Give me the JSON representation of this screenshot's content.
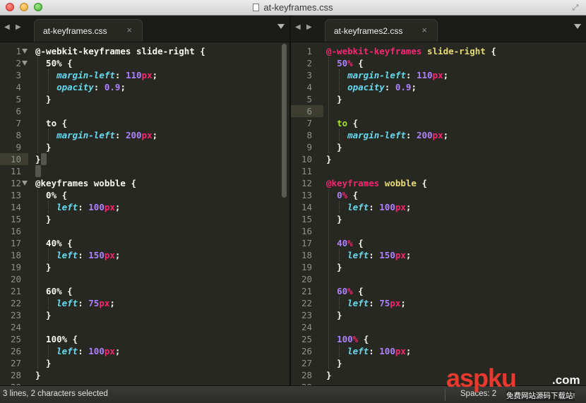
{
  "window": {
    "title": "at-keyframes.css"
  },
  "panes": [
    {
      "id": "left",
      "tab_label": "at-keyframes.css",
      "close_glyph": "×",
      "nav_back": "◀",
      "nav_forward": "▶",
      "current_line": 10,
      "selection_lines": [
        10,
        11
      ],
      "folded_lines": [
        1,
        2,
        12
      ],
      "lines": [
        [
          {
            "t": "@-webkit-keyframes slide-right {",
            "c": "w"
          }
        ],
        [
          {
            "t": "  50% {",
            "c": "w"
          }
        ],
        [
          {
            "t": "    ",
            "c": "w"
          },
          {
            "t": "margin-left",
            "c": "pr"
          },
          {
            "t": ": ",
            "c": "w"
          },
          {
            "t": "110",
            "c": "num"
          },
          {
            "t": "px",
            "c": "unit"
          },
          {
            "t": ";",
            "c": "w"
          }
        ],
        [
          {
            "t": "    ",
            "c": "w"
          },
          {
            "t": "opacity",
            "c": "pr"
          },
          {
            "t": ": ",
            "c": "w"
          },
          {
            "t": "0.9",
            "c": "num"
          },
          {
            "t": ";",
            "c": "w"
          }
        ],
        [
          {
            "t": "  }",
            "c": "w"
          }
        ],
        [],
        [
          {
            "t": "  to {",
            "c": "w"
          }
        ],
        [
          {
            "t": "    ",
            "c": "w"
          },
          {
            "t": "margin-left",
            "c": "pr"
          },
          {
            "t": ": ",
            "c": "w"
          },
          {
            "t": "200",
            "c": "num"
          },
          {
            "t": "px",
            "c": "unit"
          },
          {
            "t": ";",
            "c": "w"
          }
        ],
        [
          {
            "t": "  }",
            "c": "w"
          }
        ],
        [
          {
            "t": "}",
            "c": "w"
          }
        ],
        [],
        [
          {
            "t": "@keyframes wobble {",
            "c": "w"
          }
        ],
        [
          {
            "t": "  0% {",
            "c": "w"
          }
        ],
        [
          {
            "t": "    ",
            "c": "w"
          },
          {
            "t": "left",
            "c": "pr"
          },
          {
            "t": ": ",
            "c": "w"
          },
          {
            "t": "100",
            "c": "num"
          },
          {
            "t": "px",
            "c": "unit"
          },
          {
            "t": ";",
            "c": "w"
          }
        ],
        [
          {
            "t": "  }",
            "c": "w"
          }
        ],
        [],
        [
          {
            "t": "  40% {",
            "c": "w"
          }
        ],
        [
          {
            "t": "    ",
            "c": "w"
          },
          {
            "t": "left",
            "c": "pr"
          },
          {
            "t": ": ",
            "c": "w"
          },
          {
            "t": "150",
            "c": "num"
          },
          {
            "t": "px",
            "c": "unit"
          },
          {
            "t": ";",
            "c": "w"
          }
        ],
        [
          {
            "t": "  }",
            "c": "w"
          }
        ],
        [],
        [
          {
            "t": "  60% {",
            "c": "w"
          }
        ],
        [
          {
            "t": "    ",
            "c": "w"
          },
          {
            "t": "left",
            "c": "pr"
          },
          {
            "t": ": ",
            "c": "w"
          },
          {
            "t": "75",
            "c": "num"
          },
          {
            "t": "px",
            "c": "unit"
          },
          {
            "t": ";",
            "c": "w"
          }
        ],
        [
          {
            "t": "  }",
            "c": "w"
          }
        ],
        [],
        [
          {
            "t": "  100% {",
            "c": "w"
          }
        ],
        [
          {
            "t": "    ",
            "c": "w"
          },
          {
            "t": "left",
            "c": "pr"
          },
          {
            "t": ": ",
            "c": "w"
          },
          {
            "t": "100",
            "c": "num"
          },
          {
            "t": "px",
            "c": "unit"
          },
          {
            "t": ";",
            "c": "w"
          }
        ],
        [
          {
            "t": "  }",
            "c": "w"
          }
        ],
        [
          {
            "t": "}",
            "c": "w"
          }
        ],
        []
      ]
    },
    {
      "id": "right",
      "tab_label": "at-keyframes2.css",
      "close_glyph": "×",
      "nav_back": "◀",
      "nav_forward": "▶",
      "current_line": 6,
      "selection_lines": [],
      "folded_lines": [],
      "lines": [
        [
          {
            "t": "@-webkit-keyframes",
            "c": "at"
          },
          {
            "t": " ",
            "c": "w"
          },
          {
            "t": "slide-right",
            "c": "y"
          },
          {
            "t": " {",
            "c": "w"
          }
        ],
        [
          {
            "t": "  ",
            "c": "w"
          },
          {
            "t": "50",
            "c": "num"
          },
          {
            "t": "%",
            "c": "unit"
          },
          {
            "t": " {",
            "c": "w"
          }
        ],
        [
          {
            "t": "    ",
            "c": "w"
          },
          {
            "t": "margin-left",
            "c": "pr"
          },
          {
            "t": ": ",
            "c": "w"
          },
          {
            "t": "110",
            "c": "num"
          },
          {
            "t": "px",
            "c": "unit"
          },
          {
            "t": ";",
            "c": "w"
          }
        ],
        [
          {
            "t": "    ",
            "c": "w"
          },
          {
            "t": "opacity",
            "c": "pr"
          },
          {
            "t": ": ",
            "c": "w"
          },
          {
            "t": "0.9",
            "c": "num"
          },
          {
            "t": ";",
            "c": "w"
          }
        ],
        [
          {
            "t": "  }",
            "c": "w"
          }
        ],
        [],
        [
          {
            "t": "  ",
            "c": "w"
          },
          {
            "t": "to",
            "c": "g"
          },
          {
            "t": " {",
            "c": "w"
          }
        ],
        [
          {
            "t": "    ",
            "c": "w"
          },
          {
            "t": "margin-left",
            "c": "pr"
          },
          {
            "t": ": ",
            "c": "w"
          },
          {
            "t": "200",
            "c": "num"
          },
          {
            "t": "px",
            "c": "unit"
          },
          {
            "t": ";",
            "c": "w"
          }
        ],
        [
          {
            "t": "  }",
            "c": "w"
          }
        ],
        [
          {
            "t": "}",
            "c": "w"
          }
        ],
        [],
        [
          {
            "t": "@keyframes",
            "c": "at"
          },
          {
            "t": " ",
            "c": "w"
          },
          {
            "t": "wobble",
            "c": "y"
          },
          {
            "t": " {",
            "c": "w"
          }
        ],
        [
          {
            "t": "  ",
            "c": "w"
          },
          {
            "t": "0",
            "c": "num"
          },
          {
            "t": "%",
            "c": "unit"
          },
          {
            "t": " {",
            "c": "w"
          }
        ],
        [
          {
            "t": "    ",
            "c": "w"
          },
          {
            "t": "left",
            "c": "pr"
          },
          {
            "t": ": ",
            "c": "w"
          },
          {
            "t": "100",
            "c": "num"
          },
          {
            "t": "px",
            "c": "unit"
          },
          {
            "t": ";",
            "c": "w"
          }
        ],
        [
          {
            "t": "  }",
            "c": "w"
          }
        ],
        [],
        [
          {
            "t": "  ",
            "c": "w"
          },
          {
            "t": "40",
            "c": "num"
          },
          {
            "t": "%",
            "c": "unit"
          },
          {
            "t": " {",
            "c": "w"
          }
        ],
        [
          {
            "t": "    ",
            "c": "w"
          },
          {
            "t": "left",
            "c": "pr"
          },
          {
            "t": ": ",
            "c": "w"
          },
          {
            "t": "150",
            "c": "num"
          },
          {
            "t": "px",
            "c": "unit"
          },
          {
            "t": ";",
            "c": "w"
          }
        ],
        [
          {
            "t": "  }",
            "c": "w"
          }
        ],
        [],
        [
          {
            "t": "  ",
            "c": "w"
          },
          {
            "t": "60",
            "c": "num"
          },
          {
            "t": "%",
            "c": "unit"
          },
          {
            "t": " {",
            "c": "w"
          }
        ],
        [
          {
            "t": "    ",
            "c": "w"
          },
          {
            "t": "left",
            "c": "pr"
          },
          {
            "t": ": ",
            "c": "w"
          },
          {
            "t": "75",
            "c": "num"
          },
          {
            "t": "px",
            "c": "unit"
          },
          {
            "t": ";",
            "c": "w"
          }
        ],
        [
          {
            "t": "  }",
            "c": "w"
          }
        ],
        [],
        [
          {
            "t": "  ",
            "c": "w"
          },
          {
            "t": "100",
            "c": "num"
          },
          {
            "t": "%",
            "c": "unit"
          },
          {
            "t": " {",
            "c": "w"
          }
        ],
        [
          {
            "t": "    ",
            "c": "w"
          },
          {
            "t": "left",
            "c": "pr"
          },
          {
            "t": ": ",
            "c": "w"
          },
          {
            "t": "100",
            "c": "num"
          },
          {
            "t": "px",
            "c": "unit"
          },
          {
            "t": ";",
            "c": "w"
          }
        ],
        [
          {
            "t": "  }",
            "c": "w"
          }
        ],
        [
          {
            "t": "}",
            "c": "w"
          }
        ],
        []
      ]
    }
  ],
  "status": {
    "left_text": "3 lines, 2 characters selected",
    "right_text": "Spaces: 2"
  },
  "watermark": {
    "main": "aspku",
    "suffix": ".com",
    "sub": "免费网站源码下载站!"
  },
  "colors": {
    "background": "#272822",
    "keyword": "#f92672",
    "string": "#e6db74",
    "selector": "#a6e22e",
    "property": "#66d9ef",
    "number": "#ae81ff",
    "text": "#f8f8f2"
  },
  "icons": {
    "fullscreen": "fullscreen-arrows-icon",
    "tab_menu": "chevron-down-icon",
    "document": "document-icon"
  }
}
